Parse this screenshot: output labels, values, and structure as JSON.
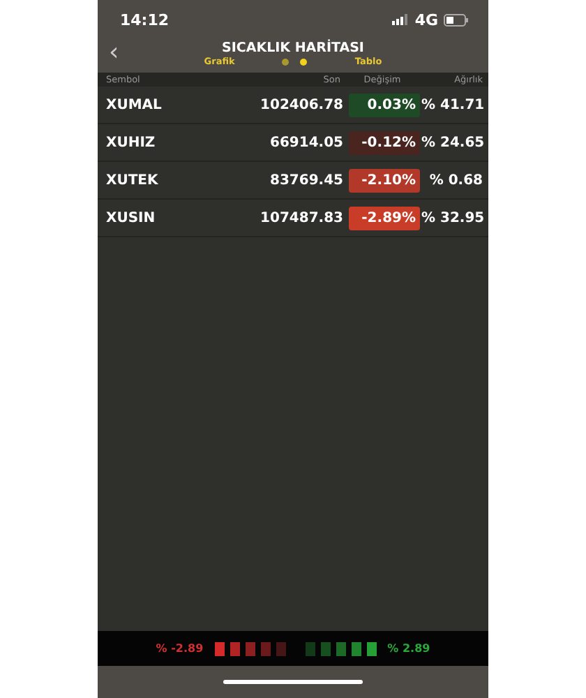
{
  "status_bar": {
    "time": "14:12",
    "network": "4G"
  },
  "header": {
    "back": "‹",
    "title": "SICAKLIK HARİTASI",
    "left_label": "Grafik",
    "right_label": "Tablo",
    "dots": [
      {
        "selected": false
      },
      {
        "selected": true
      }
    ]
  },
  "table": {
    "columns": [
      "Sembol",
      "Son",
      "Değişim",
      "Ağırlık"
    ],
    "rows": [
      {
        "symbol": "XUMAL",
        "last": "102406.78",
        "change": "0.03%",
        "color": "#1e4a26",
        "weight": "% 41.71"
      },
      {
        "symbol": "XUHIZ",
        "last": "66914.05",
        "change": "-0.12%",
        "color": "#4a2520",
        "weight": "% 24.65"
      },
      {
        "symbol": "XUTEK",
        "last": "83769.45",
        "change": "-2.10%",
        "color": "#b2382a",
        "weight": "% 0.68"
      },
      {
        "symbol": "XUSIN",
        "last": "107487.83",
        "change": "-2.89%",
        "color": "#c83c28",
        "weight": "% 32.95"
      }
    ]
  },
  "legend": {
    "min": "% -2.89",
    "max": "% 2.89",
    "swatches": [
      {
        "color": "#d42a2a"
      },
      {
        "color": "#b02424"
      },
      {
        "color": "#8c1f1f"
      },
      {
        "color": "#6a1a1a"
      },
      {
        "color": "#461616"
      },
      {
        "color": "#123a18"
      },
      {
        "color": "#17501f"
      },
      {
        "color": "#1c6a26"
      },
      {
        "color": "#21842e"
      },
      {
        "color": "#26a036"
      }
    ]
  }
}
